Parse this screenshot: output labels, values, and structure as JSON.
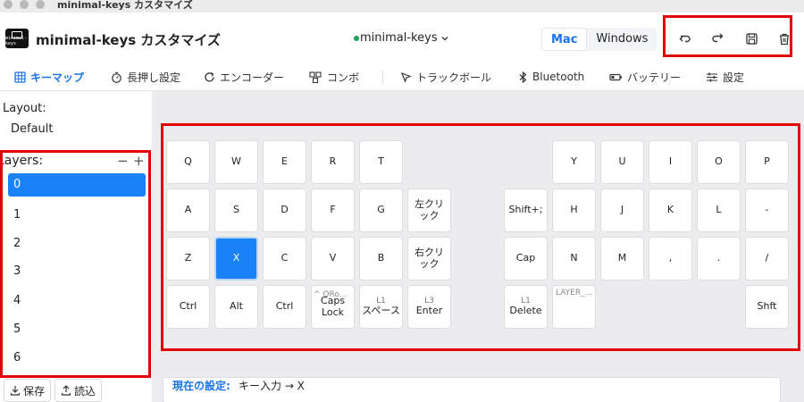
{
  "window": {
    "title": "minimal-keys カスタマイズ"
  },
  "header": {
    "logo_text": "minimal-keys",
    "app_title": "minimal-keys カスタマイズ",
    "keyboard_select": "minimal-keys",
    "os_options": {
      "mac": "Mac",
      "windows": "Windows"
    }
  },
  "tabs": [
    {
      "label": "キーマップ",
      "icon": "grid-icon"
    },
    {
      "label": "長押し設定",
      "icon": "timer-icon"
    },
    {
      "label": "エンコーダー",
      "icon": "rotate-icon"
    },
    {
      "label": "コンボ",
      "icon": "combo-icon"
    },
    {
      "label": "トラックボール",
      "icon": "pointer-icon"
    },
    {
      "label": "Bluetooth",
      "icon": "bluetooth-icon"
    },
    {
      "label": "バッテリー",
      "icon": "battery-icon"
    },
    {
      "label": "設定",
      "icon": "sliders-icon"
    }
  ],
  "sidebar": {
    "layout_label": "Layout:",
    "layout_value": "Default",
    "layers_label": "Layers:",
    "minus": "−",
    "plus": "+",
    "layers": [
      "0",
      "1",
      "2",
      "3",
      "4",
      "5",
      "6"
    ],
    "save_label": "保存",
    "load_label": "読込"
  },
  "keys": [
    {
      "main": "Q"
    },
    {
      "main": "W"
    },
    {
      "main": "E"
    },
    {
      "main": "R"
    },
    {
      "main": "T"
    },
    {
      "main": "Y"
    },
    {
      "main": "U"
    },
    {
      "main": "I"
    },
    {
      "main": "O"
    },
    {
      "main": "P"
    },
    {
      "main": "A"
    },
    {
      "main": "S"
    },
    {
      "main": "D"
    },
    {
      "main": "F"
    },
    {
      "main": "G"
    },
    {
      "main": "左クリック"
    },
    {
      "main": "Shift+;"
    },
    {
      "main": "H"
    },
    {
      "main": "J"
    },
    {
      "main": "K"
    },
    {
      "main": "L"
    },
    {
      "main": "-"
    },
    {
      "main": "Z"
    },
    {
      "main": "X"
    },
    {
      "main": "C"
    },
    {
      "main": "V"
    },
    {
      "main": "B"
    },
    {
      "main": "右クリック"
    },
    {
      "main": "Cap"
    },
    {
      "main": "N"
    },
    {
      "main": "M"
    },
    {
      "main": ","
    },
    {
      "main": "."
    },
    {
      "main": "/"
    },
    {
      "main": "Ctrl"
    },
    {
      "main": "Alt"
    },
    {
      "main": "Ctrl"
    },
    {
      "main": "Caps Lock",
      "overlay": "^ QRo..."
    },
    {
      "sub": "L1",
      "main": "スペース"
    },
    {
      "sub": "L3",
      "main": "Enter"
    },
    {
      "sub": "L1",
      "main": "Delete"
    },
    {
      "topleft": "LAYER_..."
    },
    {
      "main": "Shft"
    }
  ],
  "status": {
    "label": "現在の設定:",
    "value": "キー入力 → X"
  },
  "colors": {
    "accent": "#1a82f7",
    "highlight_box": "#e00000",
    "status_green": "#1fa463"
  }
}
